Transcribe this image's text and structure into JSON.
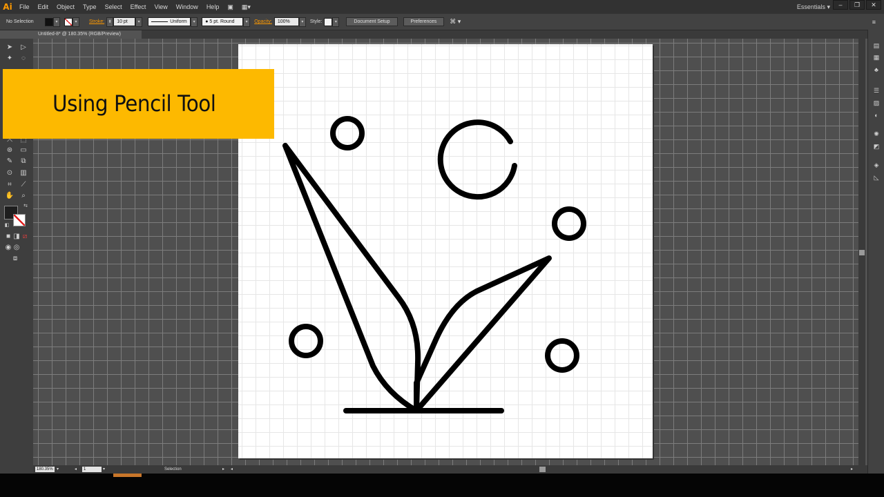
{
  "menubar": {
    "logo": "Ai",
    "items": [
      "File",
      "Edit",
      "Object",
      "Type",
      "Select",
      "Effect",
      "View",
      "Window",
      "Help"
    ],
    "workspace": "Essentials",
    "workspace_caret": "▾"
  },
  "control_bar": {
    "selection": "No Selection",
    "stroke_label": "Stroke:",
    "stroke_weight": "10 pt",
    "profile": "Uniform",
    "brush": "5 pt. Round",
    "opacity_label": "Opacity:",
    "opacity": "100%",
    "style_label": "Style:",
    "document_setup": "Document Setup",
    "preferences": "Preferences"
  },
  "document": {
    "tab_title": "Untitled-8* @ 180.35% (RGB/Preview)"
  },
  "status_bar": {
    "zoom": "180.35%",
    "artboard": "1",
    "tool": "Selection"
  },
  "overlay": {
    "title": "Using Pencil Tool"
  },
  "colors": {
    "accent": "#fdb900",
    "app_logo": "#ff9a00",
    "stroke": "#000000"
  }
}
